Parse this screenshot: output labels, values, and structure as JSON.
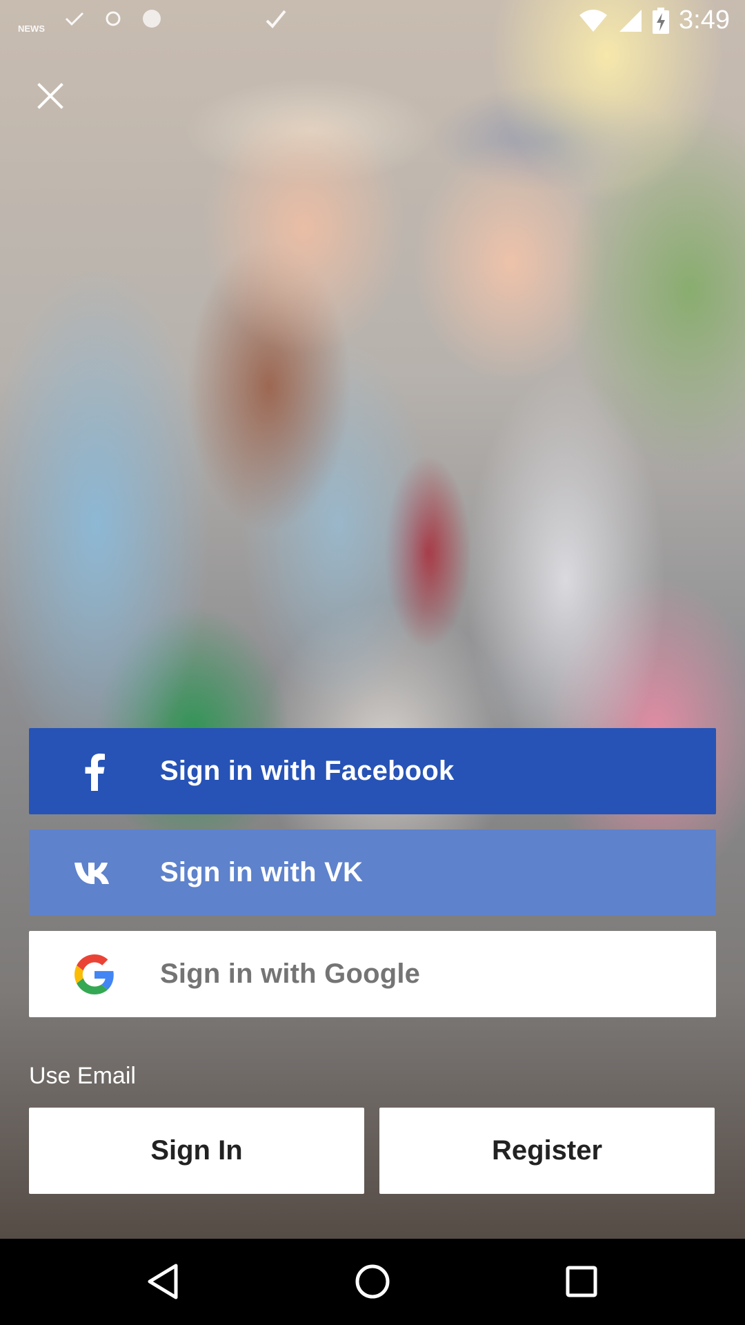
{
  "status_bar": {
    "time": "3:49",
    "left_icons": [
      "news-icon",
      "check-icon",
      "sync-icon",
      "circle-icon",
      "done-icon"
    ],
    "news_label": "NEWS",
    "right_icons": [
      "wifi-icon",
      "signal-icon",
      "battery-charging-icon"
    ]
  },
  "close": {
    "icon": "close-icon"
  },
  "social": {
    "facebook_label": "Sign in with Facebook",
    "vk_label": "Sign in with VK",
    "google_label": "Sign in with Google",
    "facebook_icon": "facebook-icon",
    "vk_icon": "vk-icon",
    "google_icon": "google-icon"
  },
  "email": {
    "heading": "Use Email",
    "signin_label": "Sign In",
    "register_label": "Register"
  },
  "nav": {
    "icons": [
      "back-icon",
      "home-icon",
      "recents-icon"
    ]
  },
  "colors": {
    "facebook": "#2753b6",
    "vk": "#5e82cc",
    "google_bg": "#ffffff",
    "google_text": "#747474"
  }
}
